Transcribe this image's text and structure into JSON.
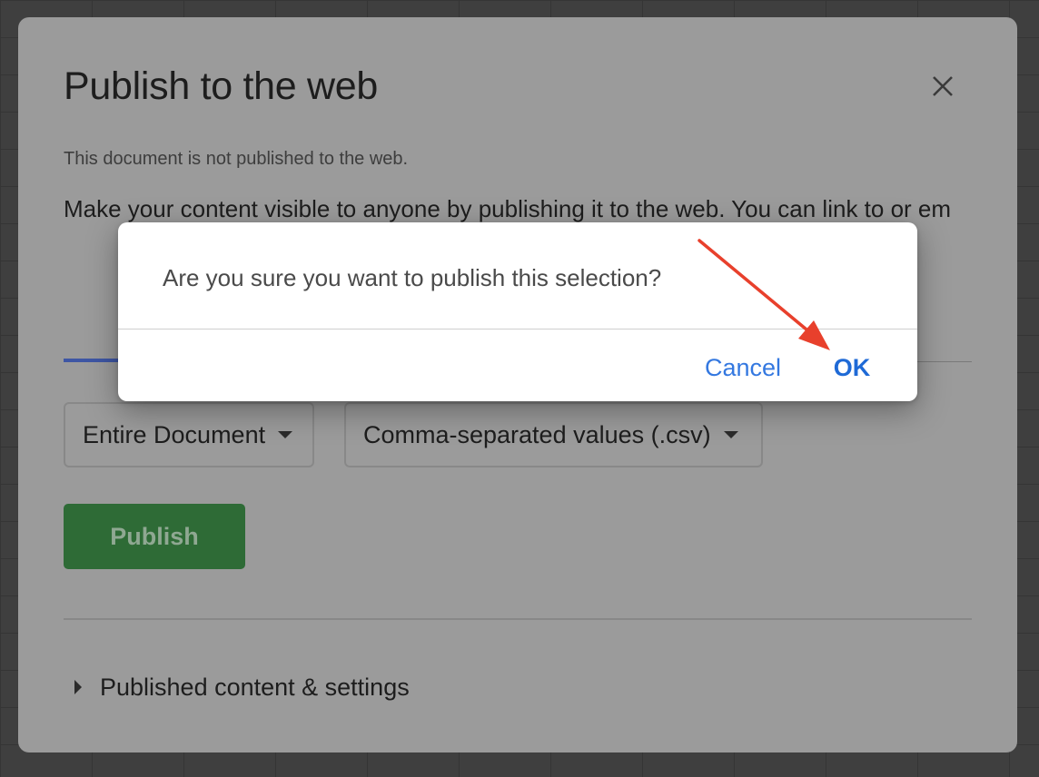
{
  "dialog": {
    "title": "Publish to the web",
    "status": "This document is not published to the web.",
    "description": "Make your content visible to anyone by publishing it to the web. You can link to or em"
  },
  "selectors": {
    "range": "Entire Document",
    "format": "Comma-separated values (.csv)"
  },
  "publish_label": "Publish",
  "published_section_label": "Published content & settings",
  "confirm": {
    "question": "Are you sure you want to publish this selection?",
    "cancel_label": "Cancel",
    "ok_label": "OK"
  },
  "colors": {
    "primary_button": "#2e6b36",
    "link_blue": "#1f6ad6",
    "annotation_arrow": "#e8402c"
  },
  "icons": {
    "close": "close-icon",
    "dropdown": "chevron-down-icon",
    "expand": "chevron-right-icon"
  }
}
